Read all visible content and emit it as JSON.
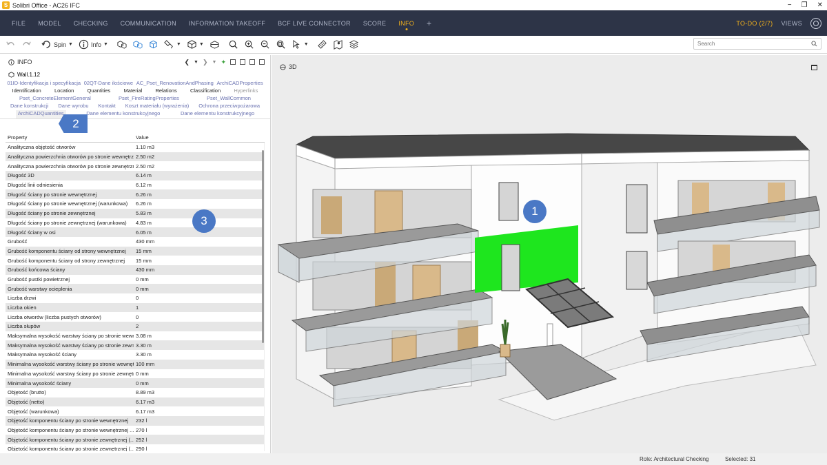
{
  "titlebar": {
    "app_title": "Solibri Office - AC26 IFC",
    "minimize": "−",
    "maximize": "❐",
    "close": "✕"
  },
  "menu": {
    "items": [
      "FILE",
      "MODEL",
      "CHECKING",
      "COMMUNICATION",
      "INFORMATION TAKEOFF",
      "BCF LIVE CONNECTOR",
      "SCORE",
      "INFO",
      "+"
    ],
    "active": "INFO",
    "todo": "TO-DO (2/7)",
    "views": "VIEWS"
  },
  "toolbar": {
    "spin_label": "Spin",
    "info_label": "Info",
    "search_placeholder": "Search"
  },
  "panel": {
    "title": "INFO",
    "object_name": "Wall.1.12",
    "tab_rows": [
      [
        "01ID-Identyfikacja i specyfikacja",
        "02QT-Dane ilościowe",
        "AC_Pset_RenovationAndPhasing",
        "ArchiCADProperties"
      ],
      [
        "Identification",
        "Location",
        "Quantities",
        "Material",
        "Relations",
        "Classification",
        "Hyperlinks"
      ],
      [
        "Pset_ConcreteElementGeneral",
        "Pset_FireRatingProperties",
        "Pset_WallCommon"
      ],
      [
        "Dane konstrukcji",
        "Dane wyrobu",
        "Kontakt",
        "Koszt materiału (wyrażenia)",
        "Ochrona przeciwpożarowa"
      ],
      [
        "ArchiCADQuantities",
        "Dane elementu konstrukcyjnego",
        "Dane elementu konstrukcyjnego"
      ]
    ],
    "columns": [
      "Property",
      "Value"
    ],
    "rows": [
      [
        "Analityczna objętość otworów",
        "1.10 m3"
      ],
      [
        "Analityczna powierzchnia otworów po stronie wewnętrznej",
        "2.50 m2"
      ],
      [
        "Analityczna powierzchnia otworów po stronie zewnętrznej",
        "2.50 m2"
      ],
      [
        "Długość 3D",
        "6.14 m"
      ],
      [
        "Długość linii odniesienia",
        "6.12 m"
      ],
      [
        "Długość ściany po stronie wewnętrznej",
        "6.26 m"
      ],
      [
        "Długość ściany po stronie wewnętrznej (warunkowa)",
        "6.26 m"
      ],
      [
        "Długość ściany po stronie zewnętrznej",
        "5.83 m"
      ],
      [
        "Długość ściany po stronie zewnętrznej (warunkowa)",
        "4.83 m"
      ],
      [
        "Długość ściany w osi",
        "6.05 m"
      ],
      [
        "Grubość",
        "430 mm"
      ],
      [
        "Grubość komponentu ściany od strony wewnętrznej",
        "15 mm"
      ],
      [
        "Grubość komponentu ściany od strony zewnętrznej",
        "15 mm"
      ],
      [
        "Grubość końcowa ściany",
        "430 mm"
      ],
      [
        "Grubość pustki powietrznej",
        "0 mm"
      ],
      [
        "Grubość warstwy ocieplenia",
        "0 mm"
      ],
      [
        "Liczba drzwi",
        "0"
      ],
      [
        "Liczba okien",
        "1"
      ],
      [
        "Liczba otworów (liczba pustych otworów)",
        "0"
      ],
      [
        "Liczba słupów",
        "2"
      ],
      [
        "Maksymalna wysokość warstwy ściany po stronie wewnętrznej",
        "3.08 m"
      ],
      [
        "Maksymalna wysokość warstwy ściany po stronie zewnętrznej",
        "3.30 m"
      ],
      [
        "Maksymalna wysokość ściany",
        "3.30 m"
      ],
      [
        "Minimalna wysokość warstwy ściany po stronie wewnętrznej",
        "100 mm"
      ],
      [
        "Minimalna wysokość warstwy ściany po stronie zewnętrznej",
        "0 mm"
      ],
      [
        "Minimalna wysokość ściany",
        "0 mm"
      ],
      [
        "Objętość (brutto)",
        "8.89 m3"
      ],
      [
        "Objętość (netto)",
        "6.17 m3"
      ],
      [
        "Objętość (warunkowa)",
        "6.17 m3"
      ],
      [
        "Objętość komponentu ściany po stronie wewnętrznej",
        "232 l"
      ],
      [
        "Objętość komponentu ściany po stronie wewnętrznej ...",
        "270 l"
      ],
      [
        "Objętość komponentu ściany po stronie zewnętrznej (...",
        "252 l"
      ],
      [
        "Objętość komponentu ściany po stronie zewnętrznej (...",
        "290 l"
      ]
    ]
  },
  "viewport": {
    "label": "3D"
  },
  "callouts": {
    "one": "1",
    "two": "2",
    "three": "3"
  },
  "status": {
    "role": "Role: Architectural Checking",
    "selected": "Selected: 31"
  },
  "colors": {
    "menu_bg": "#2d3447",
    "accent": "#f3b21c",
    "selection": "#1ee61e",
    "badge": "#4a78c5"
  }
}
